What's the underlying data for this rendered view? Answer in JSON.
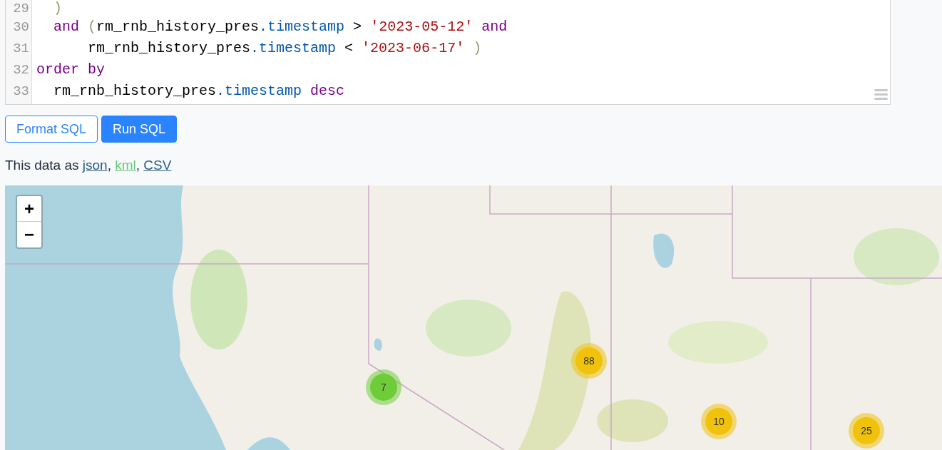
{
  "editor": {
    "lines": [
      {
        "number": "29",
        "tokens": [
          {
            "kind": "paren",
            "text": "  )"
          }
        ]
      },
      {
        "number": "30",
        "tokens": [
          {
            "kind": "keyword",
            "text": "  and"
          },
          {
            "kind": "paren",
            "text": " ("
          },
          {
            "kind": "plain",
            "text": "rm_rnb_history_pres"
          },
          {
            "kind": "property",
            "text": ".timestamp"
          },
          {
            "kind": "plain",
            "text": " > "
          },
          {
            "kind": "string",
            "text": "'2023-05-12'"
          },
          {
            "kind": "keyword",
            "text": " and"
          }
        ]
      },
      {
        "number": "31",
        "tokens": [
          {
            "kind": "plain",
            "text": "      rm_rnb_history_pres"
          },
          {
            "kind": "property",
            "text": ".timestamp"
          },
          {
            "kind": "plain",
            "text": " < "
          },
          {
            "kind": "string",
            "text": "'2023-06-17'"
          },
          {
            "kind": "paren",
            "text": " )"
          }
        ]
      },
      {
        "number": "32",
        "tokens": [
          {
            "kind": "keyword",
            "text": "order by"
          }
        ]
      },
      {
        "number": "33",
        "tokens": [
          {
            "kind": "plain",
            "text": "  rm_rnb_history_pres"
          },
          {
            "kind": "property",
            "text": ".timestamp"
          },
          {
            "kind": "keyword",
            "text": " desc"
          }
        ]
      }
    ]
  },
  "buttons": [
    {
      "label": "Format SQL",
      "kind": "outline"
    },
    {
      "label": "Run SQL",
      "kind": "primary"
    }
  ],
  "export": {
    "prefix": "This data as ",
    "separator": ", ",
    "links": [
      {
        "label": "json",
        "color": "#2a5d84"
      },
      {
        "label": "kml",
        "color": "#67c97c"
      },
      {
        "label": "CSV",
        "color": "#2a5d84"
      }
    ]
  },
  "map": {
    "zoom": [
      "+",
      "−"
    ],
    "clusters": [
      {
        "count": "7",
        "color": "#6ecc39"
      },
      {
        "count": "88",
        "color": "#f0c20c"
      },
      {
        "count": "10",
        "color": "#f0c20c"
      },
      {
        "count": "25",
        "color": "#f0c20c"
      }
    ]
  }
}
